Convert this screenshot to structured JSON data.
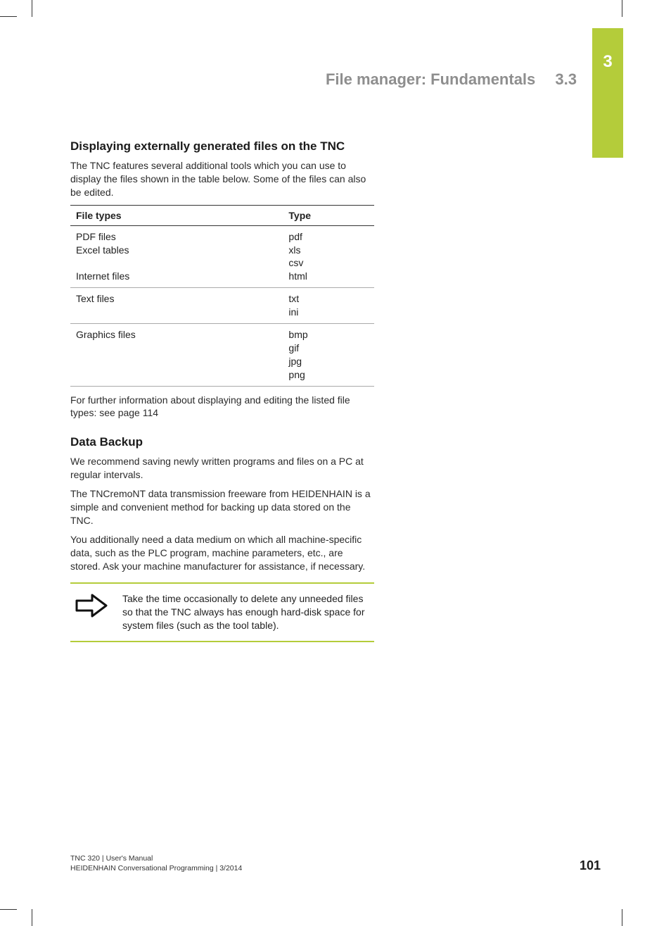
{
  "chapter_tab": "3",
  "header": {
    "title": "File manager: Fundamentals",
    "section": "3.3"
  },
  "section1": {
    "heading": "Displaying externally generated files on the TNC",
    "intro": "The TNC features several additional tools which you can use to display the files shown in the table below. Some of the files can also be edited.",
    "table": {
      "headers": [
        "File types",
        "Type"
      ],
      "rows": [
        {
          "name": "PDF files\nExcel tables\n\nInternet files",
          "types": "pdf\nxls\ncsv\nhtml"
        },
        {
          "name": "Text files",
          "types": "txt\nini"
        },
        {
          "name": "Graphics files",
          "types": "bmp\ngif\njpg\npng"
        }
      ]
    },
    "note_after_table": "For further information about displaying and editing the listed file types: see page 114"
  },
  "section2": {
    "heading": "Data Backup",
    "paragraphs": [
      "We recommend saving newly written programs and files on a PC at regular intervals.",
      "The TNCremoNT data transmission freeware from HEIDENHAIN is a simple and convenient method for backing up data stored on the TNC.",
      "You additionally need a data medium on which all machine-specific data, such as the PLC program, machine parameters, etc., are stored. Ask your machine manufacturer for assistance, if necessary."
    ],
    "callout": "Take the time occasionally to delete any unneeded files so that the TNC always has enough hard-disk space for system files (such as the tool table)."
  },
  "footer": {
    "line1": "TNC 320 | User's Manual",
    "line2": "HEIDENHAIN Conversational Programming | 3/2014",
    "page": "101"
  }
}
